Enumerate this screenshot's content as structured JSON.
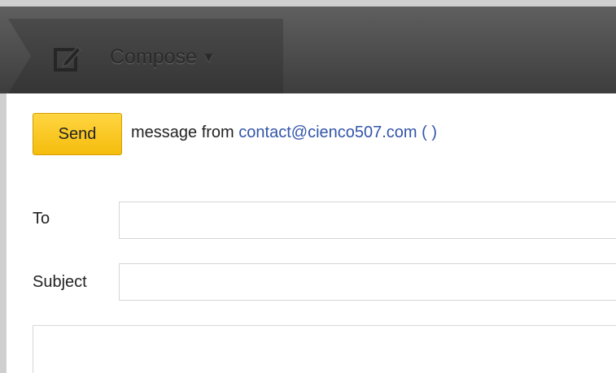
{
  "toolbar": {
    "compose_label": "Compose",
    "compose_caret": "▼",
    "compose_icon": "compose-pencil-icon"
  },
  "message": {
    "send_label": "Send",
    "from_prefix": "message from",
    "from_email": "contact@cienco507.com",
    "from_name_parens": "( )"
  },
  "fields": {
    "to_label": "To",
    "to_value": "",
    "subject_label": "Subject",
    "subject_value": "",
    "body_value": ""
  },
  "colors": {
    "send_button": "#f5bd0d",
    "link": "#3355aa",
    "toolbar": "#3d3d3d"
  }
}
